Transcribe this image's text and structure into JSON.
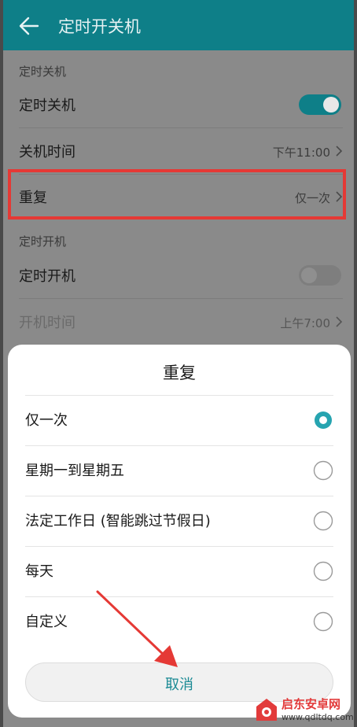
{
  "colors": {
    "accent": "#0e7f88",
    "highlight": "#e53935",
    "radio_selected": "#26a4b0",
    "watermark_red": "#e23b3b"
  },
  "header": {
    "title": "定时开关机",
    "back_icon": "arrow-left"
  },
  "shutdown_section": {
    "header": "定时关机",
    "toggle_label": "定时关机",
    "toggle_on": true,
    "time_label": "关机时间",
    "time_value": "下午11:00",
    "repeat_label": "重复",
    "repeat_value": "仅一次"
  },
  "boot_section": {
    "header": "定时开机",
    "toggle_label": "定时开机",
    "toggle_on": false,
    "time_label": "开机时间",
    "time_value": "上午7:00"
  },
  "dialog": {
    "title": "重复",
    "options": [
      {
        "label": "仅一次",
        "selected": true
      },
      {
        "label": "星期一到星期五",
        "selected": false
      },
      {
        "label": "法定工作日 (智能跳过节假日)",
        "selected": false
      },
      {
        "label": "每天",
        "selected": false
      },
      {
        "label": "自定义",
        "selected": false
      }
    ],
    "cancel_label": "取消"
  },
  "watermark": {
    "title": "启东安卓网",
    "url": "www.qdltdq.com"
  }
}
